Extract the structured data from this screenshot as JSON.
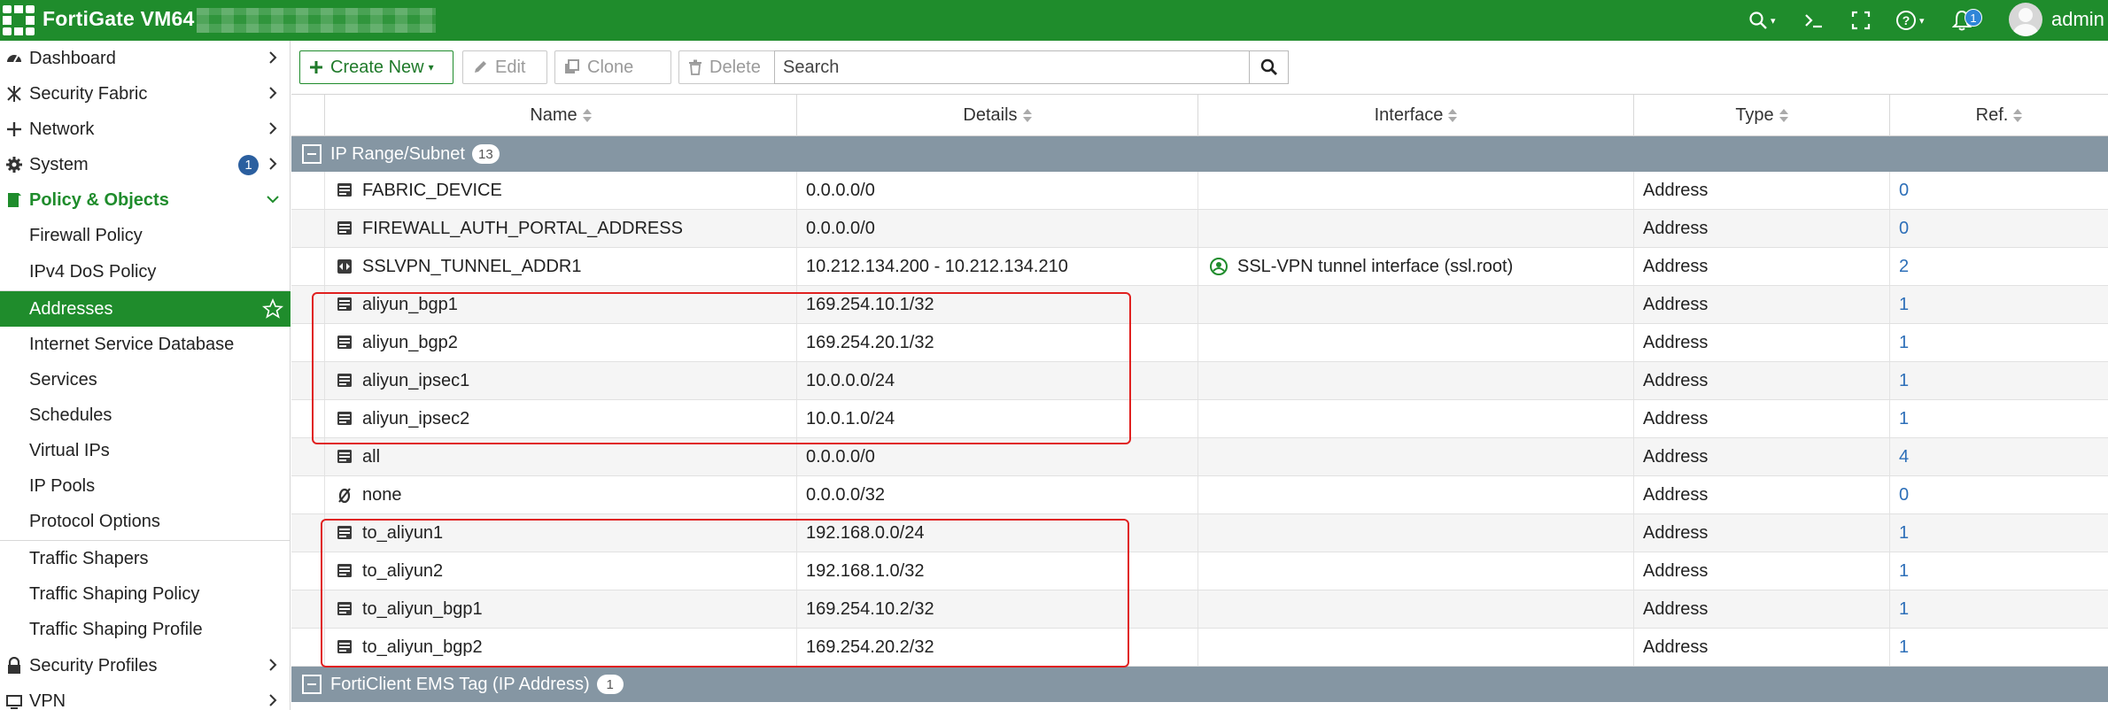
{
  "topbar": {
    "title": "FortiGate VM64",
    "notification_count": "1",
    "user": "admin",
    "icons": [
      "search-icon",
      "cli-console-icon",
      "fullscreen-icon",
      "help-icon",
      "bell-icon"
    ],
    "accent_color": "#1f8c2c"
  },
  "sidebar": {
    "items": [
      {
        "label": "Dashboard",
        "icon": "dashboard-icon"
      },
      {
        "label": "Security Fabric",
        "icon": "security-fabric-icon"
      },
      {
        "label": "Network",
        "icon": "network-icon"
      },
      {
        "label": "System",
        "icon": "gear-icon",
        "badge": "1"
      },
      {
        "label": "Policy & Objects",
        "icon": "policy-icon"
      },
      {
        "label": "Firewall Policy"
      },
      {
        "label": "IPv4 DoS Policy"
      },
      {
        "label": "Addresses"
      },
      {
        "label": "Internet Service Database"
      },
      {
        "label": "Services"
      },
      {
        "label": "Schedules"
      },
      {
        "label": "Virtual IPs"
      },
      {
        "label": "IP Pools"
      },
      {
        "label": "Protocol Options"
      },
      {
        "label": "Traffic Shapers"
      },
      {
        "label": "Traffic Shaping Policy"
      },
      {
        "label": "Traffic Shaping Profile"
      },
      {
        "label": "Security Profiles",
        "icon": "lock-icon"
      },
      {
        "label": "VPN",
        "icon": "vpn-icon"
      }
    ]
  },
  "toolbar": {
    "create_new": "Create New",
    "edit": "Edit",
    "clone": "Clone",
    "delete": "Delete",
    "search_placeholder": "Search"
  },
  "table": {
    "columns": [
      "Name",
      "Details",
      "Interface",
      "Type",
      "Ref."
    ],
    "groups": [
      {
        "label": "IP Range/Subnet",
        "count": "13",
        "rows": [
          {
            "name": "FABRIC_DEVICE",
            "details": "0.0.0.0/0",
            "interface": "",
            "type": "Address",
            "ref": "0",
            "icon": "address-icon"
          },
          {
            "name": "FIREWALL_AUTH_PORTAL_ADDRESS",
            "details": "0.0.0.0/0",
            "interface": "",
            "type": "Address",
            "ref": "0",
            "icon": "address-icon"
          },
          {
            "name": "SSLVPN_TUNNEL_ADDR1",
            "details": "10.212.134.200 - 10.212.134.210",
            "interface": "SSL-VPN tunnel interface (ssl.root)",
            "type": "Address",
            "ref": "2",
            "icon": "ip-range-icon"
          },
          {
            "name": "aliyun_bgp1",
            "details": "169.254.10.1/32",
            "interface": "",
            "type": "Address",
            "ref": "1",
            "icon": "address-icon"
          },
          {
            "name": "aliyun_bgp2",
            "details": "169.254.20.1/32",
            "interface": "",
            "type": "Address",
            "ref": "1",
            "icon": "address-icon"
          },
          {
            "name": "aliyun_ipsec1",
            "details": "10.0.0.0/24",
            "interface": "",
            "type": "Address",
            "ref": "1",
            "icon": "address-icon"
          },
          {
            "name": "aliyun_ipsec2",
            "details": "10.0.1.0/24",
            "interface": "",
            "type": "Address",
            "ref": "1",
            "icon": "address-icon"
          },
          {
            "name": "all",
            "details": "0.0.0.0/0",
            "interface": "",
            "type": "Address",
            "ref": "4",
            "icon": "address-icon"
          },
          {
            "name": "none",
            "details": "0.0.0.0/32",
            "interface": "",
            "type": "Address",
            "ref": "0",
            "icon": "none-address-icon"
          },
          {
            "name": "to_aliyun1",
            "details": "192.168.0.0/24",
            "interface": "",
            "type": "Address",
            "ref": "1",
            "icon": "address-icon"
          },
          {
            "name": "to_aliyun2",
            "details": "192.168.1.0/32",
            "interface": "",
            "type": "Address",
            "ref": "1",
            "icon": "address-icon"
          },
          {
            "name": "to_aliyun_bgp1",
            "details": "169.254.10.2/32",
            "interface": "",
            "type": "Address",
            "ref": "1",
            "icon": "address-icon"
          },
          {
            "name": "to_aliyun_bgp2",
            "details": "169.254.20.2/32",
            "interface": "",
            "type": "Address",
            "ref": "1",
            "icon": "address-icon"
          }
        ]
      },
      {
        "label": "FortiClient EMS Tag (IP Address)",
        "count": "1",
        "rows": []
      }
    ]
  }
}
